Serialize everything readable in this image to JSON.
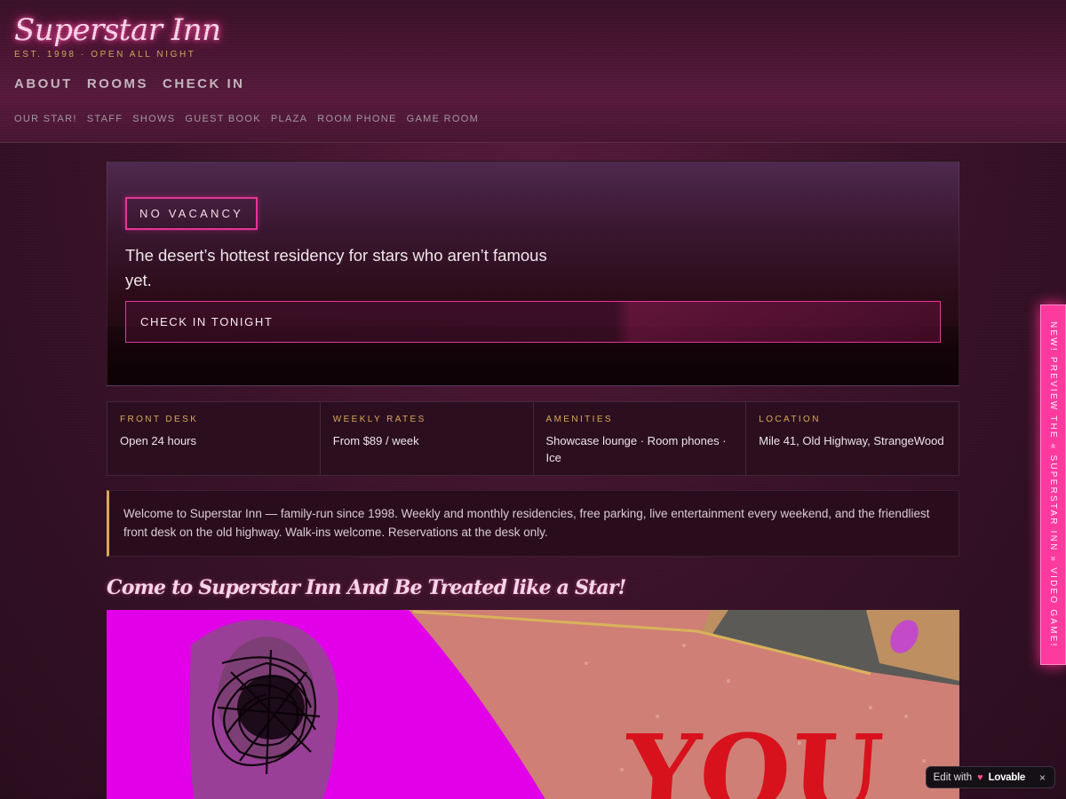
{
  "header": {
    "logo": "Superstar Inn",
    "tagline": "EST. 1998 · OPEN ALL NIGHT",
    "main_nav": [
      "ABOUT",
      "ROOMS",
      "CHECK IN"
    ],
    "sub_nav": [
      "OUR STAR!",
      "STAFF",
      "SHOWS",
      "GUEST BOOK",
      "PLAZA",
      "ROOM PHONE",
      "GAME ROOM"
    ]
  },
  "hero": {
    "badge": "NO VACANCY",
    "text": "The desert’s hottest residency for stars who aren’t famous yet.",
    "cta": "CHECK IN TONIGHT"
  },
  "info": [
    {
      "label": "FRONT DESK",
      "value": "Open 24 hours"
    },
    {
      "label": "WEEKLY RATES",
      "value": "From $89 / week"
    },
    {
      "label": "AMENITIES",
      "value": "Showcase lounge · Room phones · Ice"
    },
    {
      "label": "LOCATION",
      "value": "Mile 41, Old Highway, StrangeWood"
    }
  ],
  "welcome": "Welcome to Superstar Inn — family-run since 1998. Weekly and monthly residencies, free parking, live entertainment every weekend, and the friendliest front desk on the old highway. Walk-ins welcome. Reservations at the desk only.",
  "promo": {
    "heading": "Come to Superstar Inn And Be Treated like a Star!",
    "star_text": "YOU"
  },
  "side_tab": "NEW! PREVIEW THE « SUPERSTAR INN » VIDEO GAME!",
  "badge": {
    "label": "Edit with",
    "brand": "Lovable",
    "close": "×",
    "heart_icon": "heart-icon"
  },
  "colors": {
    "accent_pink": "#e8349a",
    "gold": "#d8a95a",
    "magenta": "#e100e8",
    "background": "#3a1329"
  }
}
